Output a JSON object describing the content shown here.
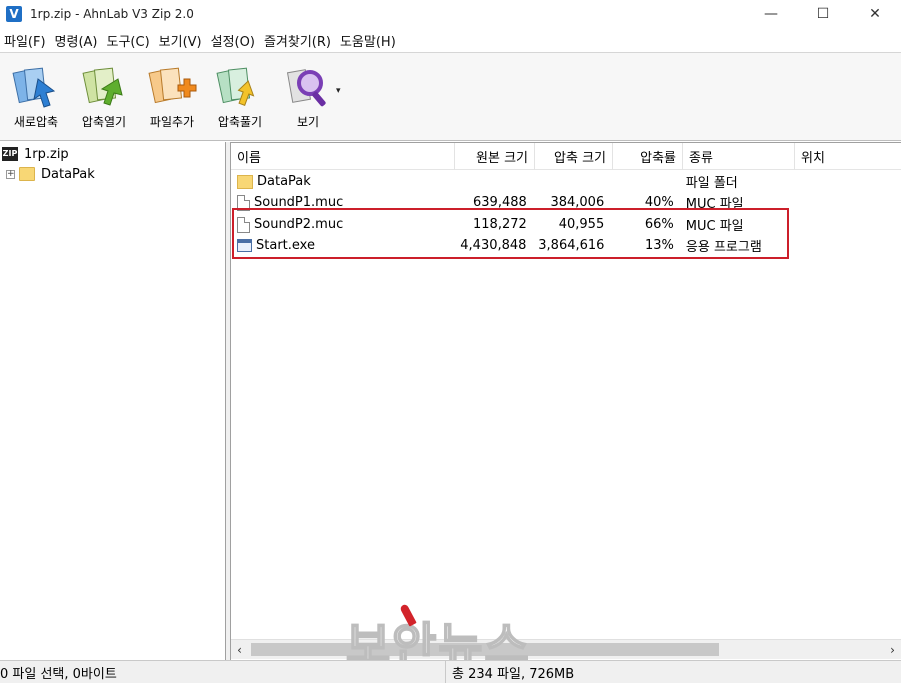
{
  "window": {
    "icon_letter": "V",
    "title": "1rp.zip - AhnLab V3 Zip 2.0",
    "minimize": "—",
    "maximize": "☐",
    "close": "✕"
  },
  "menu": [
    {
      "label": "파일(F)"
    },
    {
      "label": "명령(A)"
    },
    {
      "label": "도구(C)"
    },
    {
      "label": "보기(V)"
    },
    {
      "label": "설정(O)"
    },
    {
      "label": "즐겨찾기(R)"
    },
    {
      "label": "도움말(H)"
    }
  ],
  "toolbar": {
    "new": "새로압축",
    "open": "압축열기",
    "add": "파일추가",
    "extract": "압축풀기",
    "view": "보기",
    "dropdown": "▾"
  },
  "tree": {
    "root": "1rp.zip",
    "zip_badge": "ZIP",
    "child": "DataPak",
    "expander": "+"
  },
  "list": {
    "headers": [
      "이름",
      "원본 크기",
      "압축 크기",
      "압축률",
      "종류",
      "위치"
    ],
    "rows": [
      {
        "name": "DataPak",
        "orig": "",
        "comp": "",
        "ratio": "",
        "type": "파일 폴더",
        "icon": "folder-icon"
      },
      {
        "name": "SoundP1.muc",
        "orig": "639,488",
        "comp": "384,006",
        "ratio": "40%",
        "type": "MUC 파일",
        "icon": "file-icon"
      },
      {
        "name": "SoundP2.muc",
        "orig": "118,272",
        "comp": "40,955",
        "ratio": "66%",
        "type": "MUC 파일",
        "icon": "file-icon"
      },
      {
        "name": "Start.exe",
        "orig": "4,430,848",
        "comp": "3,864,616",
        "ratio": "13%",
        "type": "응용 프로그램",
        "icon": "exe-icon"
      }
    ]
  },
  "scrollbar": {
    "left": "‹",
    "right": "›"
  },
  "watermark": "보안뉴스",
  "status": {
    "selection": "0 파일 선택, 0바이트",
    "total": "총 234 파일, 726MB"
  },
  "colors": {
    "highlight": "#cc1f2a",
    "accent": "#1f6fc5"
  }
}
